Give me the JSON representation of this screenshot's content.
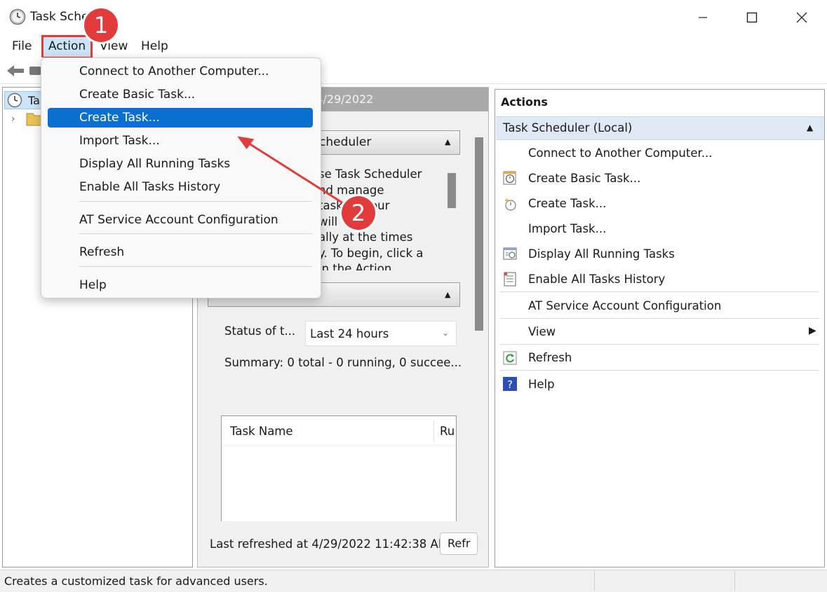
{
  "window": {
    "title": "Task Sche"
  },
  "menubar": {
    "file": "File",
    "action": "Action",
    "view": "View",
    "help": "Help"
  },
  "tree": {
    "root_label": "Ta"
  },
  "center": {
    "header": "ary (Last refreshed: 4/29/2022",
    "section1_title": "cheduler",
    "desc_lines": [
      "se Task Scheduler",
      "nd manage",
      "tasks    your",
      "will    out",
      "ally at the times",
      "y. To begin, click a",
      "in the Action"
    ],
    "status_label": "Status of t...",
    "status_select": "Last 24 hours",
    "summary": "Summary: 0 total - 0 running, 0 succee...",
    "col_task_name": "Task Name",
    "col_run": "Ru",
    "last_refreshed": "Last refreshed at 4/29/2022 11:42:38 AM",
    "refresh_button": "Refr"
  },
  "actions": {
    "title": "Actions",
    "group": "Task Scheduler (Local)",
    "items": [
      {
        "label": "Connect to Another Computer...",
        "icon": "none"
      },
      {
        "label": "Create Basic Task...",
        "icon": "basic-task-icon"
      },
      {
        "label": "Create Task...",
        "icon": "create-task-icon"
      },
      {
        "label": "Import Task...",
        "icon": "none"
      },
      {
        "label": "Display All Running Tasks",
        "icon": "running-tasks-icon"
      },
      {
        "label": "Enable All Tasks History",
        "icon": "history-icon"
      },
      {
        "label": "AT Service Account Configuration",
        "icon": "none"
      },
      {
        "label": "View",
        "icon": "none"
      },
      {
        "label": "Refresh",
        "icon": "refresh-icon"
      },
      {
        "label": "Help",
        "icon": "help-icon"
      }
    ]
  },
  "dropdown": {
    "items": [
      "Connect to Another Computer...",
      "Create Basic Task...",
      "Create Task...",
      "Import Task...",
      "Display All Running Tasks",
      "Enable All Tasks History",
      "AT Service Account Configuration",
      "Refresh",
      "Help"
    ],
    "highlighted": "Create Task..."
  },
  "statusbar": {
    "text": "Creates a customized task for advanced users."
  },
  "annotations": {
    "badge1": "1",
    "badge2": "2"
  },
  "colors": {
    "accent": "#0b6fd0",
    "annotation": "#e23b3b",
    "menu_active_bg": "#cce4f7"
  }
}
